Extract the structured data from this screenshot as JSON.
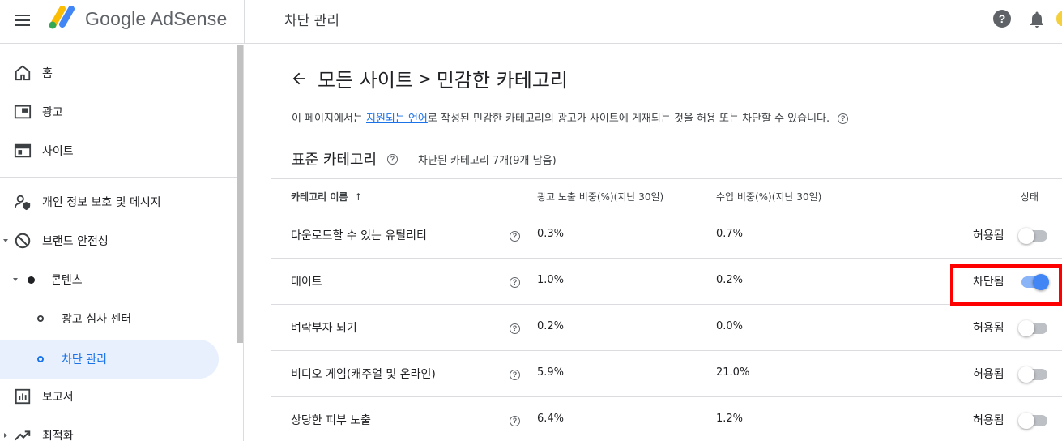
{
  "header": {
    "brand": "Google AdSense",
    "page_title": "차단 관리"
  },
  "sidebar": {
    "items": [
      {
        "label": "홈",
        "icon": "home-icon"
      },
      {
        "label": "광고",
        "icon": "ads-icon"
      },
      {
        "label": "사이트",
        "icon": "sites-icon"
      },
      {
        "label": "개인 정보 보호 및 메시지",
        "icon": "privacy-icon"
      },
      {
        "label": "브랜드 안전성",
        "icon": "block-icon"
      },
      {
        "label": "콘텐츠",
        "icon": "dot-icon"
      },
      {
        "label": "광고 심사 센터",
        "icon": "ring-icon"
      },
      {
        "label": "차단 관리",
        "icon": "ring-icon"
      },
      {
        "label": "보고서",
        "icon": "reports-icon"
      },
      {
        "label": "최적화",
        "icon": "optimize-icon"
      }
    ]
  },
  "main": {
    "crumb_parent": "모든 사이트",
    "crumb_sep": ">",
    "crumb_current": "민감한 카테고리",
    "desc_prefix": "이 페이지에서는 ",
    "desc_link": "지원되는 언어",
    "desc_suffix": "로 작성된 민감한 카테고리의 광고가 사이트에 게재되는 것을 허용 또는 차단할 수 있습니다.",
    "section_title": "표준 카테고리",
    "section_count": "차단된 카테고리 7개(9개 남음)",
    "q_mark": "?"
  },
  "table": {
    "headers": {
      "name": "카테고리 이름",
      "sort_arrow": "↑",
      "impressions": "광고 노출 비중(%)(지난 30일)",
      "revenue": "수입 비중(%)(지난 30일)",
      "status": "상태"
    },
    "rows": [
      {
        "name": "다운로드할 수 있는 유틸리티",
        "impressions": "0.3%",
        "revenue": "0.7%",
        "status": "허용됨",
        "blocked": false
      },
      {
        "name": "데이트",
        "impressions": "1.0%",
        "revenue": "0.2%",
        "status": "차단됨",
        "blocked": true
      },
      {
        "name": "벼락부자 되기",
        "impressions": "0.2%",
        "revenue": "0.0%",
        "status": "허용됨",
        "blocked": false
      },
      {
        "name": "비디오 게임(캐주얼 및 온라인)",
        "impressions": "5.9%",
        "revenue": "21.0%",
        "status": "허용됨",
        "blocked": false
      },
      {
        "name": "상당한 피부 노출",
        "impressions": "6.4%",
        "revenue": "1.2%",
        "status": "허용됨",
        "blocked": false
      }
    ]
  },
  "colors": {
    "accent": "#1a73e8",
    "active_bg": "#e8f0fe",
    "toggle_on": "#4285f4",
    "highlight": "#ff0000"
  }
}
